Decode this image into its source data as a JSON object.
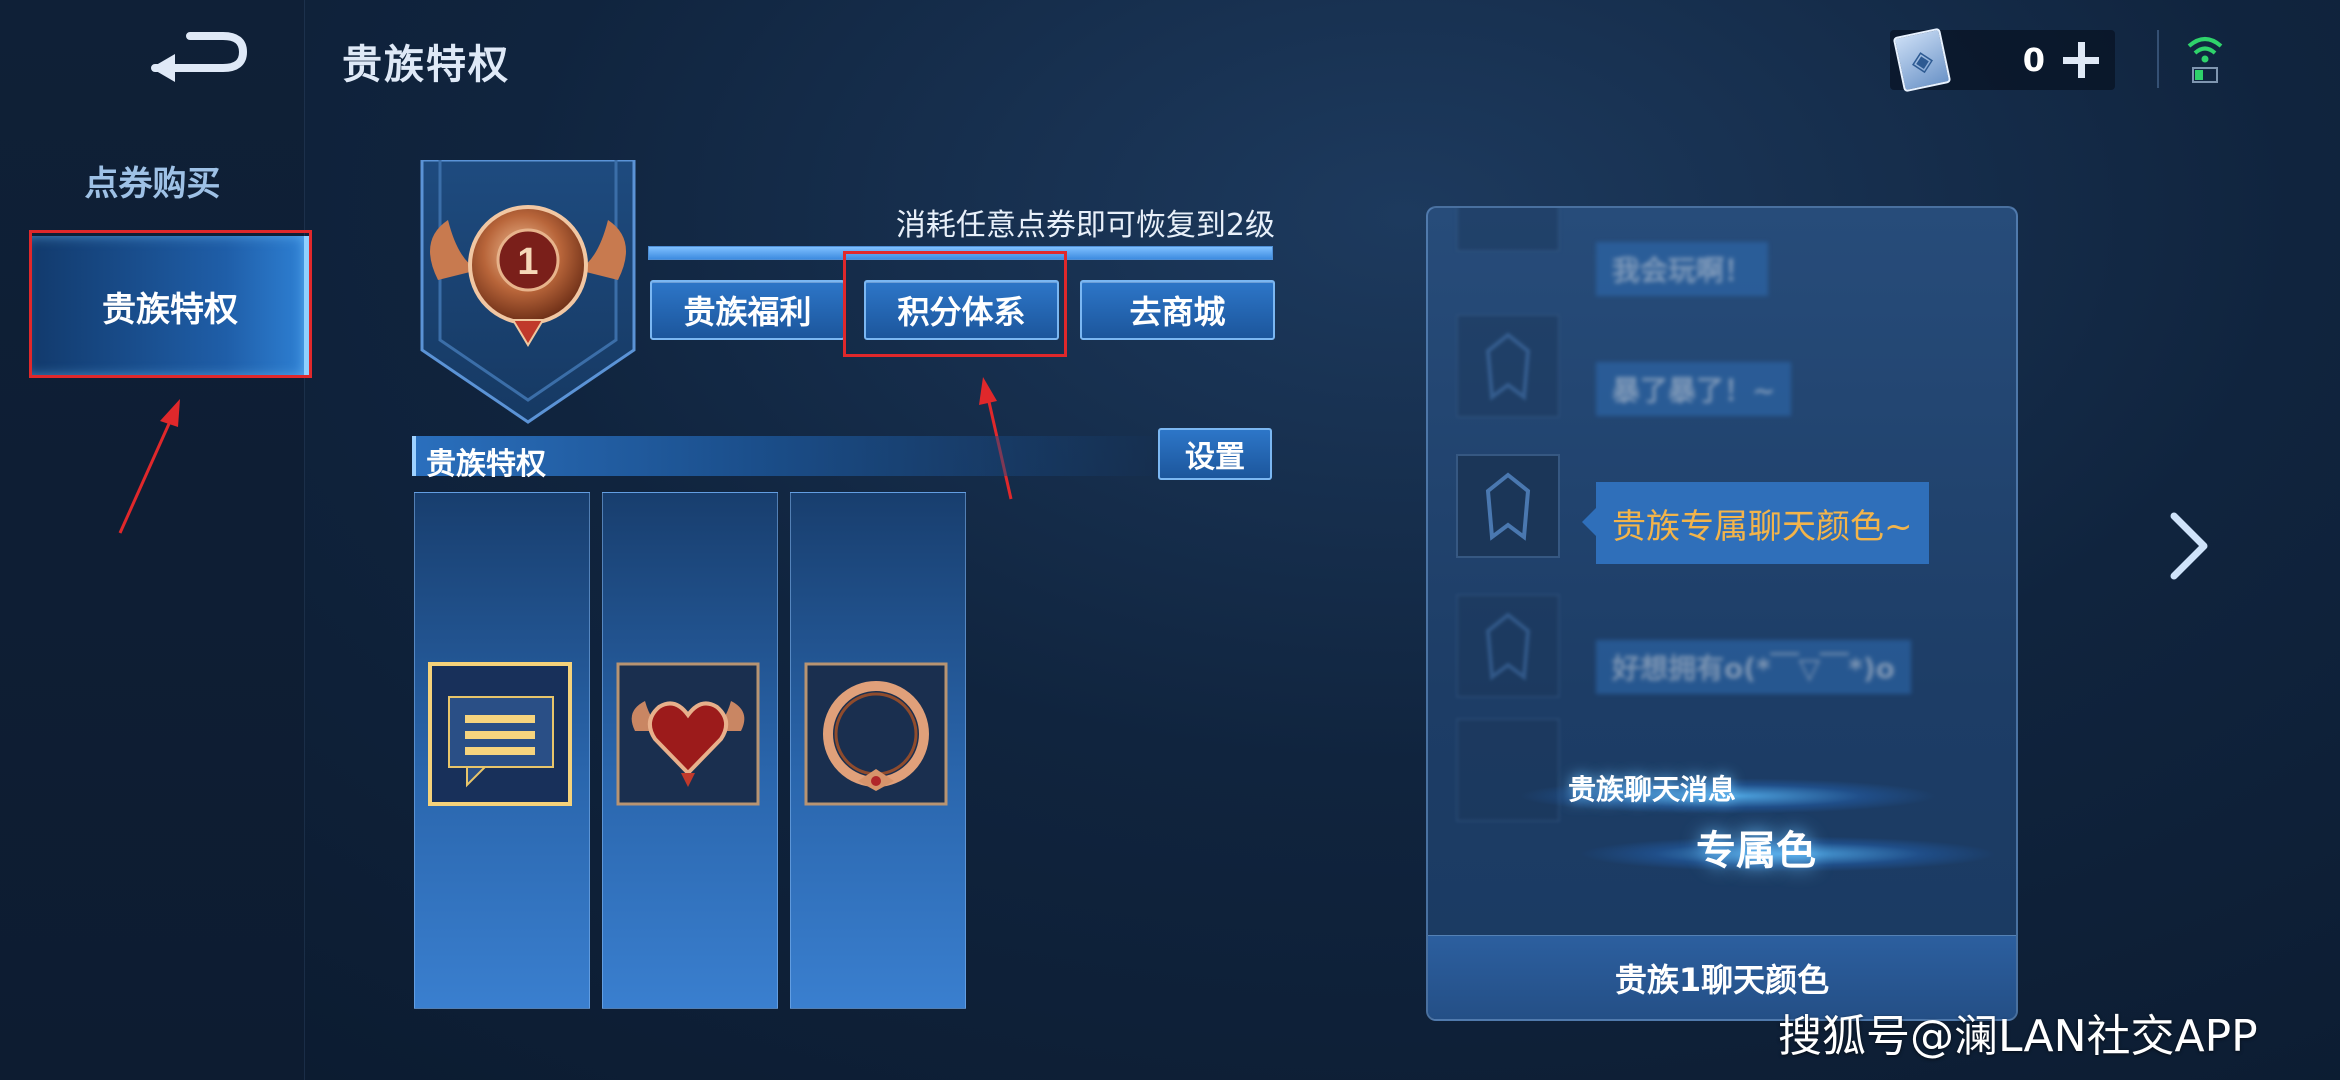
{
  "header": {
    "title": "贵族特权"
  },
  "currency": {
    "count": "0",
    "icon": "coupon-ticket-icon"
  },
  "sidebar": {
    "items": [
      {
        "label": "点券购买"
      },
      {
        "label": "贵族特权",
        "active": true
      }
    ]
  },
  "noble": {
    "level": "1",
    "restore_hint": "消耗任意点券即可恢复到2级",
    "progress": 1.0,
    "tabs": [
      {
        "label": "贵族福利"
      },
      {
        "label": "积分体系"
      },
      {
        "label": "去商城"
      }
    ]
  },
  "section": {
    "title": "贵族特权",
    "settings_label": "设置"
  },
  "privilege_cards": [
    {
      "icon": "chat-bubble-icon"
    },
    {
      "icon": "heart-badge-icon"
    },
    {
      "icon": "avatar-frame-icon"
    }
  ],
  "preview": {
    "messages": [
      {
        "text": "我会玩啊！"
      },
      {
        "text": "暴了暴了！~"
      },
      {
        "text": "贵族专属聊天颜色~"
      },
      {
        "text": "好想拥有o(*￣▽￣*)o"
      }
    ],
    "glow_label_1": "贵族聊天消息",
    "glow_label_2": "专属色",
    "footer": "贵族1聊天颜色"
  },
  "watermark": "搜狐号@澜LAN社交APP",
  "colors": {
    "highlight_red": "#e0282b",
    "chat_gold": "#f3b44a",
    "accent_blue": "#2d76c8"
  }
}
